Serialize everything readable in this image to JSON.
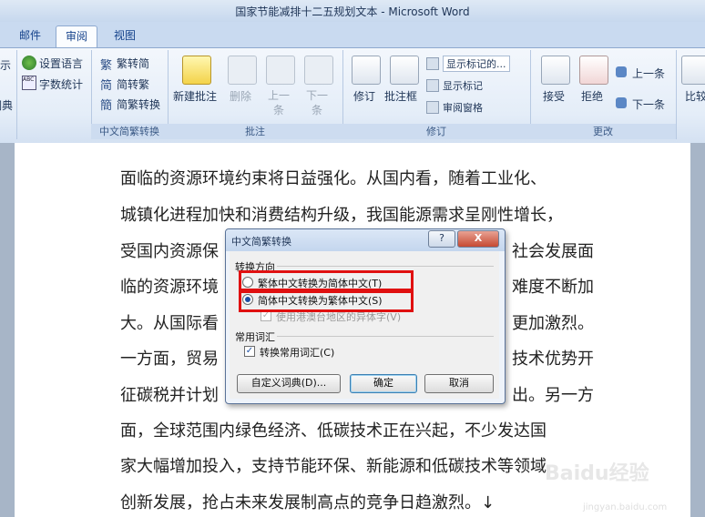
{
  "window": {
    "title": "国家节能减排十二五规划文本 - Microsoft Word"
  },
  "tabs": [
    {
      "label": "邮件"
    },
    {
      "label": "审阅"
    },
    {
      "label": "视图"
    }
  ],
  "ribbon": {
    "partial_left_a": "示",
    "partial_left_b": "词典",
    "lang": {
      "set_language": "设置语言",
      "word_count": "字数统计"
    },
    "convert": {
      "trad_to_simp": "繁转简",
      "simp_to_trad": "简转繁",
      "simp_trad_convert": "简繁转换",
      "group_label": "中文简繁转换"
    },
    "comments": {
      "new_comment": "新建批注",
      "delete": "删除",
      "previous": "上一条",
      "next": "下一条",
      "group_label": "批注"
    },
    "tracking": {
      "track_changes": "修订",
      "balloons": "批注框",
      "display_for_review": "显示标记的...",
      "show_markup": "显示标记",
      "reviewing_pane": "审阅窗格",
      "group_label": "修订"
    },
    "changes": {
      "accept": "接受",
      "reject": "拒绝",
      "previous": "上一条",
      "next": "下一条",
      "group_label": "更改"
    },
    "compare_partial": "比较"
  },
  "document": {
    "lines": [
      "面临的资源环境约束将日益强化。从国内看，随着工业化、",
      "城镇化进程加快和消费结构升级，我国能源需求呈刚性增长，",
      "受国内资源保",
      "临的资源环境",
      "大。从国际看",
      "一方面，贸易",
      "征碳税并计划",
      "面，全球范围内绿色经济、低碳技术正在兴起，不少发达国",
      "家大幅增加投入，支持节能环保、新能源和低碳技术等领域",
      "创新发展，抢占未来发展制高点的竞争日趋激烈。↓"
    ],
    "right_fragments": [
      "社会发展面",
      "难度不断加",
      "更加激烈。",
      "技术优势开",
      "出。另一方"
    ]
  },
  "dialog": {
    "title": "中文简繁转换",
    "help_btn": "?",
    "close_btn": "X",
    "direction_label": "转换方向",
    "option_trad_to_simp": "繁体中文转换为简体中文(T)",
    "option_simp_to_trad": "简体中文转换为繁体中文(S)",
    "option_hk_variant": "使用港澳台地区的异体字(V)",
    "common_vocab_label": "常用词汇",
    "convert_common_words": "转换常用词汇(C)",
    "custom_dict_btn": "自定义词典(D)...",
    "ok_btn": "确定",
    "cancel_btn": "取消",
    "selected_option": "简体中文转换为繁体中文(S)"
  },
  "watermark": {
    "logo": "Baidu经验",
    "url": "jingyan.baidu.com"
  },
  "colors": {
    "highlight": "#e01010",
    "ribbon_text": "#1f3557",
    "accent": "#15428b"
  }
}
